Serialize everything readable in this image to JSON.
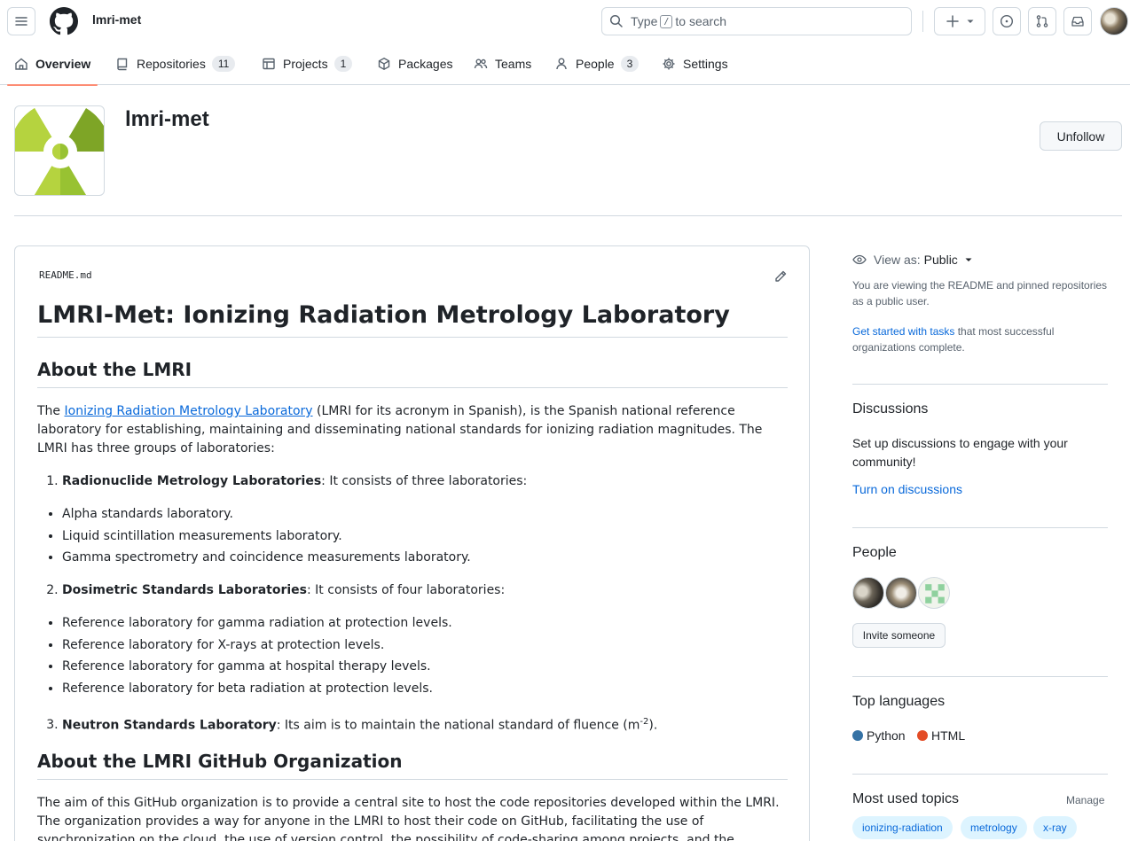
{
  "header": {
    "org_context": "lmri-met",
    "search_prefix": "Type",
    "search_key": "/",
    "search_suffix": "to search"
  },
  "orgnav": {
    "overview": "Overview",
    "repositories": "Repositories",
    "repositories_count": "11",
    "projects": "Projects",
    "projects_count": "1",
    "packages": "Packages",
    "teams": "Teams",
    "people": "People",
    "people_count": "3",
    "settings": "Settings"
  },
  "org": {
    "name": "lmri-met",
    "unfollow_label": "Unfollow"
  },
  "readme": {
    "filename": "README.md",
    "h1": "LMRI-Met: Ionizing Radiation Metrology Laboratory",
    "about_h2": "About the LMRI",
    "intro_pre": "The ",
    "intro_link": "Ionizing Radiation Metrology Laboratory",
    "intro_post": " (LMRI for its acronym in Spanish), is the Spanish national reference laboratory for establishing, maintaining and disseminating national standards for ionizing radiation magnitudes. The LMRI has three groups of laboratories:",
    "group1_bold": "Radionuclide Metrology Laboratories",
    "group1_rest": ": It consists of three laboratories:",
    "group1_items": [
      "Alpha standards laboratory.",
      "Liquid scintillation measurements laboratory.",
      "Gamma spectrometry and coincidence measurements laboratory."
    ],
    "group2_bold": "Dosimetric Standards Laboratories",
    "group2_rest": ": It consists of four laboratories:",
    "group2_items": [
      "Reference laboratory for gamma radiation at protection levels.",
      "Reference laboratory for X-rays at protection levels.",
      "Reference laboratory for gamma at hospital therapy levels.",
      "Reference laboratory for beta radiation at protection levels."
    ],
    "group3_bold": "Neutron Standards Laboratory",
    "group3_rest": ": Its aim is to maintain the national standard of fluence (m",
    "group3_sup": "-2",
    "group3_end": ").",
    "gh_h2": "About the LMRI GitHub Organization",
    "gh_para": "The aim of this GitHub organization is to provide a central site to host the code repositories developed within the LMRI. The organization provides a way for anyone in the LMRI to host their code on GitHub, facilitating the use of synchronization on the cloud, the use of version control, the possibility of code-sharing among projects, and the collaboration between LMRI members."
  },
  "sidebar": {
    "view_as_label": "View as:",
    "view_as_value": "Public",
    "view_note": "You are viewing the README and pinned repositories as a public user.",
    "tasks_link": "Get started with tasks",
    "tasks_rest": " that most successful organizations complete.",
    "discussions_title": "Discussions",
    "discussions_text": "Set up discussions to engage with your community!",
    "discussions_link": "Turn on discussions",
    "people_title": "People",
    "invite_label": "Invite someone",
    "languages_title": "Top languages",
    "languages": [
      {
        "name": "Python",
        "color": "#3572A5"
      },
      {
        "name": "HTML",
        "color": "#e34c26"
      }
    ],
    "topics_title": "Most used topics",
    "topics_manage": "Manage",
    "topics": [
      "ionizing-radiation",
      "metrology",
      "x-ray"
    ]
  }
}
